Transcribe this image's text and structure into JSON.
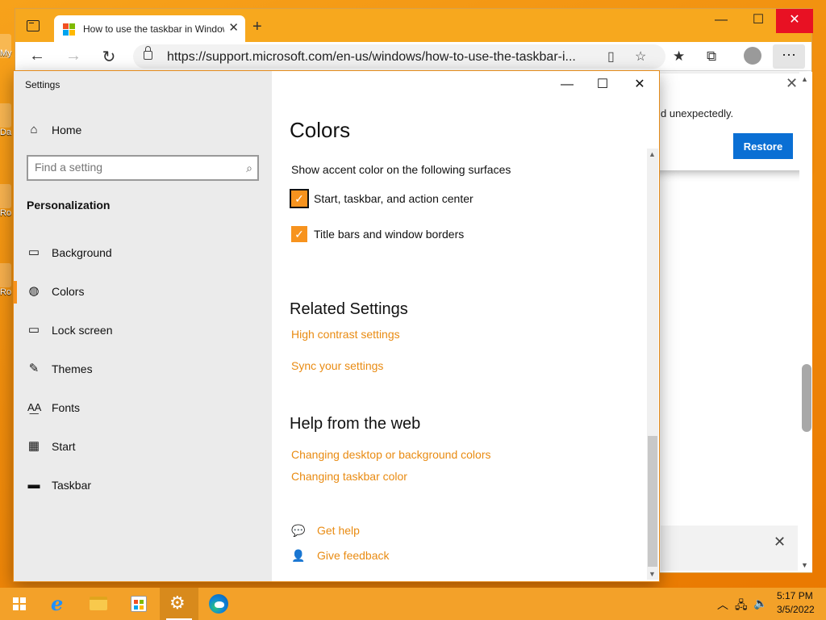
{
  "desktop": {
    "labels": [
      "My",
      "Da",
      "Ro",
      "Ro"
    ]
  },
  "browser": {
    "tab_title": "How to use the taskbar in Windows",
    "tab_close": "✕",
    "new_tab": "+",
    "url": "https://support.microsoft.com/en-us/windows/how-to-use-the-taskbar-i...",
    "restore_popup": {
      "message": "d unexpectedly.",
      "button_label": "Restore"
    }
  },
  "settings": {
    "window_title": "Settings",
    "home_label": "Home",
    "search": {
      "placeholder": "Find a setting",
      "value": ""
    },
    "section_label": "Personalization",
    "nav_items": [
      {
        "label": "Background",
        "icon": "picture-icon"
      },
      {
        "label": "Colors",
        "icon": "palette-icon",
        "active": true
      },
      {
        "label": "Lock screen",
        "icon": "lock-screen-icon"
      },
      {
        "label": "Themes",
        "icon": "themes-icon"
      },
      {
        "label": "Fonts",
        "icon": "fonts-icon"
      },
      {
        "label": "Start",
        "icon": "start-icon"
      },
      {
        "label": "Taskbar",
        "icon": "taskbar-icon"
      }
    ],
    "content": {
      "title": "Colors",
      "accent_caption": "Show accent color on the following surfaces",
      "checkboxes": [
        {
          "label": "Start, taskbar, and action center",
          "checked": true
        },
        {
          "label": "Title bars and window borders",
          "checked": true
        }
      ],
      "related_title": "Related Settings",
      "related_links": [
        "High contrast settings",
        "Sync your settings"
      ],
      "help_title": "Help from the web",
      "help_links": [
        "Changing desktop or background colors",
        "Changing taskbar color"
      ],
      "get_help": "Get help",
      "give_feedback": "Give feedback"
    }
  },
  "taskbar": {
    "time": "5:17 PM",
    "date": "3/5/2022",
    "active_app": "settings"
  },
  "colors": {
    "accent": "#f7931e",
    "link": "#e98b12",
    "taskbar": "#f3a129",
    "restore_button": "#0a6fd4",
    "close_button": "#e81123"
  }
}
